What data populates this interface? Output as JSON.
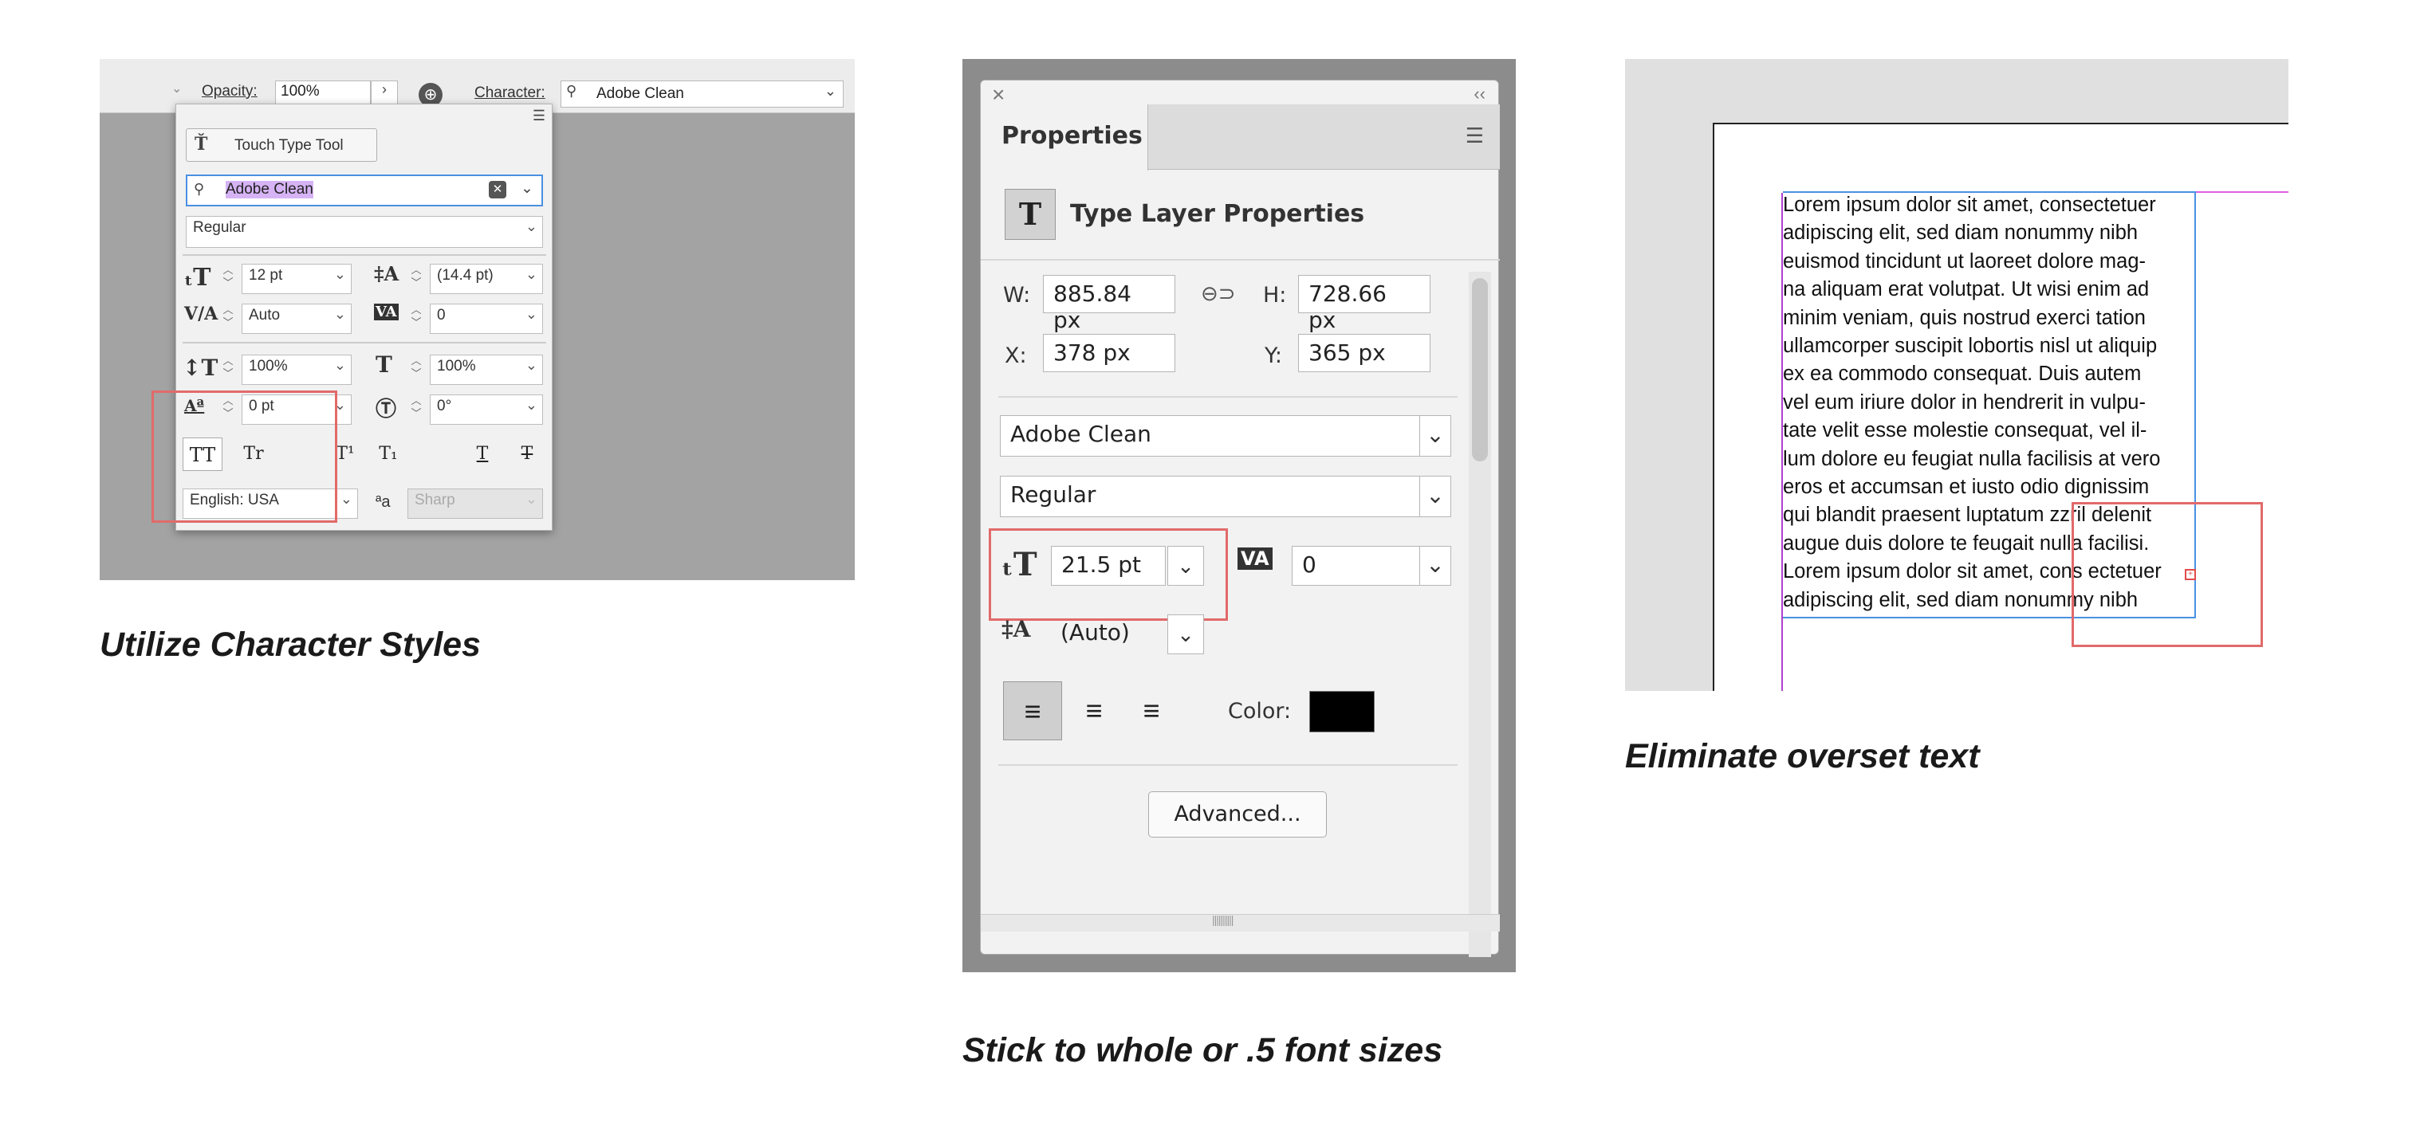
{
  "captions": {
    "panel1": "Utilize Character Styles",
    "panel2": "Stick to whole or .5 font sizes",
    "panel3": "Eliminate overset text"
  },
  "panel1": {
    "options_bar": {
      "opacity_label": "Opacity:",
      "opacity_value": "100%",
      "character_label": "Character:",
      "font_value": "Adobe Clean"
    },
    "popup": {
      "touch_type_label": "Touch Type Tool",
      "font_search_value": "Adobe Clean",
      "style_value": "Regular",
      "font_size": "12 pt",
      "leading": "(14.4 pt)",
      "kerning": "Auto",
      "tracking": "0",
      "vertical_scale": "100%",
      "horizontal_scale": "100%",
      "baseline_shift": "0 pt",
      "rotation": "0°",
      "caps_all": "TT",
      "caps_small": "Tr",
      "superscript": "T¹",
      "subscript": "T₁",
      "underline": "T",
      "strikethrough": "T",
      "language": "English: USA",
      "aa_label": "ªa",
      "antialias": "Sharp"
    }
  },
  "panel2": {
    "tab_label": "Properties",
    "section_title": "Type Layer Properties",
    "w_label": "W:",
    "w_value": "885.84 px",
    "h_label": "H:",
    "h_value": "728.66 px",
    "x_label": "X:",
    "x_value": "378 px",
    "y_label": "Y:",
    "y_value": "365 px",
    "font_family": "Adobe Clean",
    "font_style": "Regular",
    "font_size": "21.5 pt",
    "tracking": "0",
    "leading": "(Auto)",
    "color_label": "Color:",
    "color_value": "#000000",
    "advanced_label": "Advanced..."
  },
  "panel3": {
    "lines": [
      "Lorem ipsum dolor sit amet, consectetuer",
      "adipiscing elit, sed diam nonummy nibh",
      "euismod tincidunt ut laoreet dolore mag-",
      "na aliquam erat volutpat. Ut wisi enim ad",
      "minim veniam, quis nostrud exerci tation",
      "ullamcorper suscipit lobortis nisl ut aliquip",
      "ex ea commodo consequat. Duis autem",
      "vel eum iriure dolor in hendrerit in vulpu-",
      "tate velit esse molestie consequat, vel il-",
      "lum dolore eu feugiat nulla facilisis at vero",
      "eros et accumsan et iusto odio dignissim",
      "qui blandit praesent luptatum zzril delenit",
      "augue duis dolore te feugait nulla facilisi.",
      "Lorem ipsum dolor sit amet, cons ectetuer",
      "adipiscing elit, sed diam nonummy nibh"
    ]
  },
  "colors": {
    "highlight_box": "#e26a6a",
    "frame_blue": "#4a90e2",
    "margin_magenta": "#e060e0",
    "selection_purple": "#d6b3f5"
  }
}
